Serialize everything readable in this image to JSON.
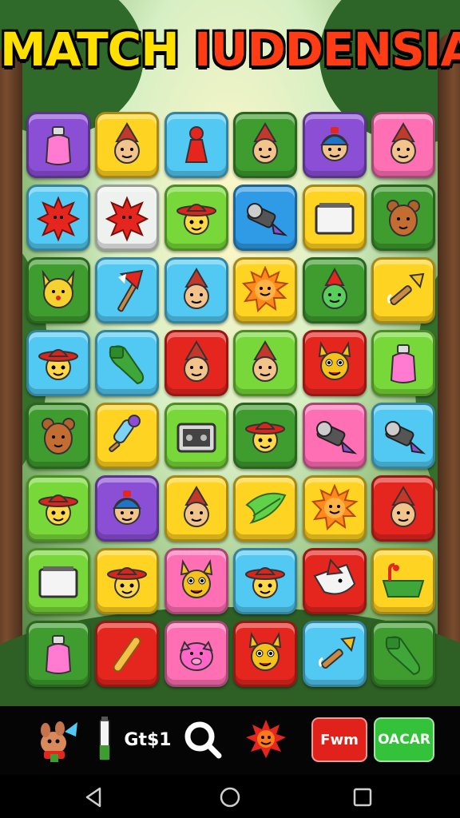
{
  "title": {
    "part1": "MATCH ",
    "part2": "IUDDENSIA"
  },
  "colors": {
    "purple": "#8b4fd6",
    "yellow": "#ffd321",
    "cyan": "#52c9f2",
    "green": "#3f9c2f",
    "lime": "#78d83a",
    "pink": "#ff6fb4",
    "red": "#e5261f",
    "blue": "#2f9be6",
    "white": "#eef2ef"
  },
  "board": [
    [
      [
        "purple",
        "bottle-icon"
      ],
      [
        "yellow",
        "gnome-face-icon"
      ],
      [
        "cyan",
        "pawn-icon"
      ],
      [
        "green",
        "gnome-face-icon"
      ],
      [
        "purple",
        "boy-face-icon"
      ],
      [
        "pink",
        "gnome-face-icon"
      ]
    ],
    [
      [
        "cyan",
        "red-splat-icon"
      ],
      [
        "white",
        "red-splat-icon"
      ],
      [
        "lime",
        "hat-face-icon"
      ],
      [
        "blue",
        "flashlight-icon"
      ],
      [
        "yellow",
        "tv-box-icon"
      ],
      [
        "green",
        "animal-face-icon"
      ]
    ],
    [
      [
        "green",
        "cat-face-icon"
      ],
      [
        "cyan",
        "axe-icon"
      ],
      [
        "cyan",
        "gnome-face-icon"
      ],
      [
        "yellow",
        "sun-face-icon"
      ],
      [
        "green",
        "green-gnome-icon"
      ],
      [
        "yellow",
        "arrow-icon"
      ]
    ],
    [
      [
        "cyan",
        "hat-face-icon"
      ],
      [
        "cyan",
        "glove-icon"
      ],
      [
        "red",
        "gnome-face-icon"
      ],
      [
        "lime",
        "gnome-face-icon"
      ],
      [
        "red",
        "critter-face-icon"
      ],
      [
        "lime",
        "bottle-icon"
      ]
    ],
    [
      [
        "green",
        "animal-face-icon"
      ],
      [
        "yellow",
        "paintbrush-icon"
      ],
      [
        "lime",
        "radio-icon"
      ],
      [
        "green",
        "hat-face-icon"
      ],
      [
        "pink",
        "flashlight-icon"
      ],
      [
        "cyan",
        "flashlight-icon"
      ]
    ],
    [
      [
        "lime",
        "hat-face-icon"
      ],
      [
        "purple",
        "boy-face-icon"
      ],
      [
        "yellow",
        "gnome-face-icon"
      ],
      [
        "yellow",
        "leaf-icon"
      ],
      [
        "yellow",
        "sun-face-icon"
      ],
      [
        "red",
        "gnome-face-icon"
      ]
    ],
    [
      [
        "lime",
        "tv-box-icon"
      ],
      [
        "yellow",
        "hat-face-icon"
      ],
      [
        "pink",
        "critter-face-icon"
      ],
      [
        "cyan",
        "hat-face-icon"
      ],
      [
        "red",
        "bird-icon"
      ],
      [
        "yellow",
        "bathtub-icon"
      ]
    ],
    [
      [
        "green",
        "bottle-icon"
      ],
      [
        "red",
        "bat-icon"
      ],
      [
        "pink",
        "pig-face-icon"
      ],
      [
        "red",
        "critter-face-icon"
      ],
      [
        "cyan",
        "arrow-icon"
      ],
      [
        "green",
        "glove-icon"
      ]
    ]
  ],
  "toolbar": {
    "counter_label": "Gt$1",
    "red_button_label": "Fwm",
    "green_button_label": "OACAR"
  }
}
